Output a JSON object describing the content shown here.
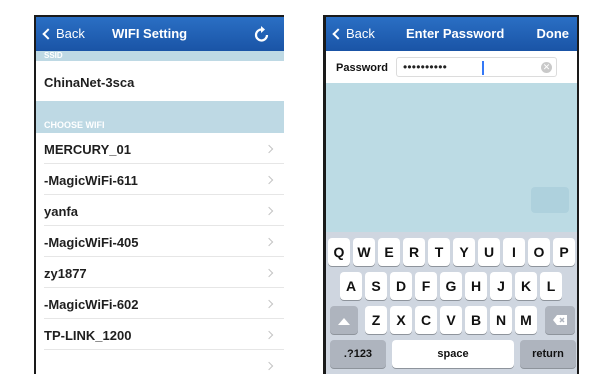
{
  "wifi_screen": {
    "back_label": "Back",
    "title": "WIFI Setting",
    "refresh_icon": "refresh-icon",
    "ssid_header": "SSID",
    "ssid_value": "ChinaNet-3sca",
    "choose_header": "CHOOSE WIFI",
    "networks": [
      "MERCURY_01",
      "-MagicWiFi-611",
      "yanfa",
      "-MagicWiFi-405",
      "zy1877",
      "-MagicWiFi-602",
      "TP-LINK_1200"
    ]
  },
  "password_screen": {
    "back_label": "Back",
    "title": "Enter Password",
    "done_label": "Done",
    "password_label": "Password",
    "password_value": "••••••••••",
    "clear_icon": "clear-icon",
    "keyboard": {
      "row1": [
        "Q",
        "W",
        "E",
        "R",
        "T",
        "Y",
        "U",
        "I",
        "O",
        "P"
      ],
      "row2": [
        "A",
        "S",
        "D",
        "F",
        "G",
        "H",
        "J",
        "K",
        "L"
      ],
      "row3": [
        "Z",
        "X",
        "C",
        "V",
        "B",
        "N",
        "M"
      ],
      "numbers_label": ".?123",
      "space_label": "space",
      "return_label": "return",
      "shift_icon": "shift-icon",
      "delete_icon": "delete-icon"
    }
  },
  "colors": {
    "navbar": "#1f5fb4",
    "section_header": "#bed9e4",
    "keyboard_bg": "#cfd6e0",
    "empty_area": "#bcdbe4"
  }
}
